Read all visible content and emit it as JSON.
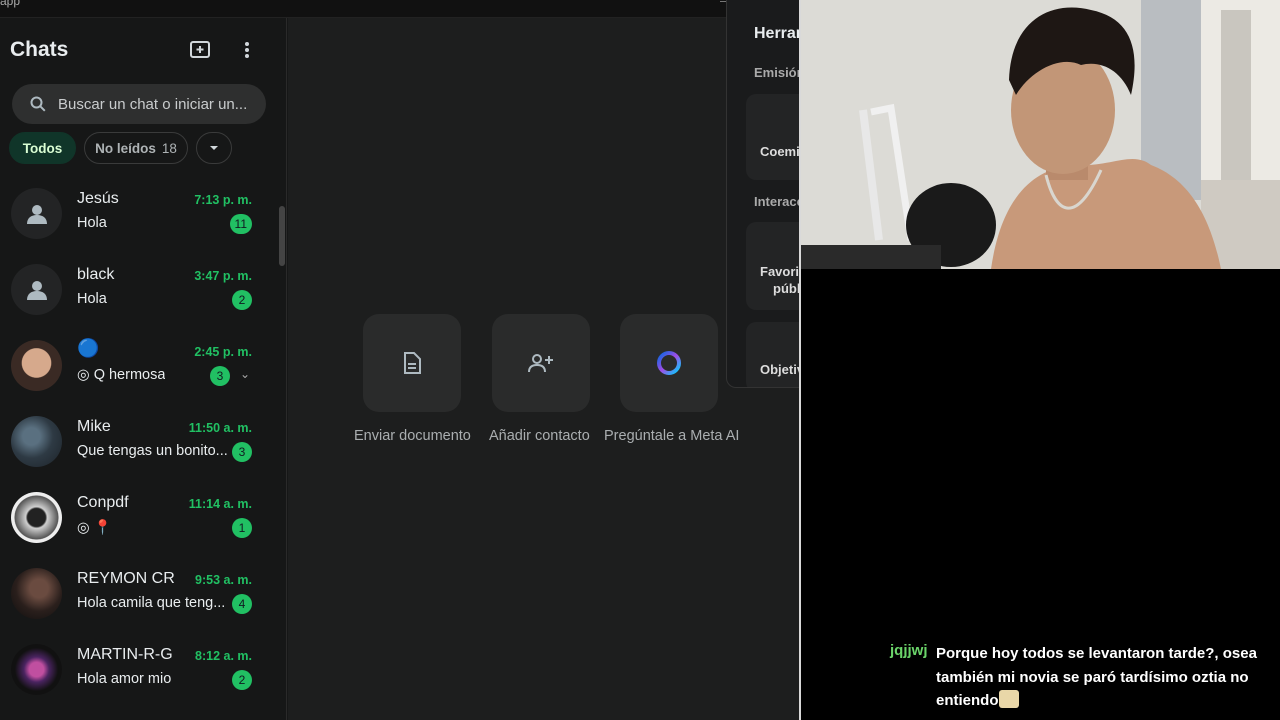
{
  "window": {
    "title_fragment": "app"
  },
  "sidebar": {
    "title": "Chats",
    "search_placeholder": "Buscar un chat o iniciar un...",
    "filters": {
      "all": "Todos",
      "unread": "No leídos",
      "unread_count": "18"
    },
    "chats": [
      {
        "name": "Jesús",
        "message": "Hola",
        "time": "7:13 p. m.",
        "unread": "11",
        "avatar": "default-avatar"
      },
      {
        "name": "black",
        "message": "Hola",
        "time": "3:47 p. m.",
        "unread": "2",
        "avatar": "default-avatar"
      },
      {
        "name": "🔵",
        "message": "Q hermosa",
        "time": "2:45 p. m.",
        "unread": "3",
        "avatar": "photo",
        "message_icon": "status-ring-icon"
      },
      {
        "name": "Mike",
        "message": "Que tengas  un bonito...",
        "time": "11:50 a. m.",
        "unread": "3",
        "avatar": "photo"
      },
      {
        "name": "Conpdf",
        "message": "📍",
        "time": "11:14 a. m.",
        "unread": "1",
        "avatar": "photo",
        "message_icon": "status-ring-icon"
      },
      {
        "name": "REYMON CR",
        "message": "Hola camila que teng...",
        "time": "9:53 a. m.",
        "unread": "4",
        "avatar": "photo"
      },
      {
        "name": "MARTIN-R-G",
        "message": "Hola amor mio",
        "time": "8:12 a. m.",
        "unread": "2",
        "avatar": "photo"
      }
    ]
  },
  "main": {
    "actions": [
      {
        "label": "Enviar documento",
        "icon": "document-icon"
      },
      {
        "label": "Añadir contacto",
        "icon": "add-contact-icon"
      },
      {
        "label": "Pregúntale a Meta AI",
        "icon": "meta-ai-icon"
      }
    ]
  },
  "tools_panel": {
    "title": "Herram",
    "section_broadcast": "Emisión",
    "cohost_label": "Coemi",
    "section_interactions": "Interacc",
    "favorites_label_1": "Favorit",
    "favorites_label_2": "públi",
    "goals_label": "Objetiv"
  },
  "stream_chat": {
    "username": "jqjjwj",
    "message": "Porque hoy todos se levantaron tarde?, osea también mi novia se paró tardísimo oztia no entiendo"
  },
  "colors": {
    "accent_green": "#21c063",
    "chip_active_bg": "#103529",
    "chat_username": "#6bd56a"
  }
}
